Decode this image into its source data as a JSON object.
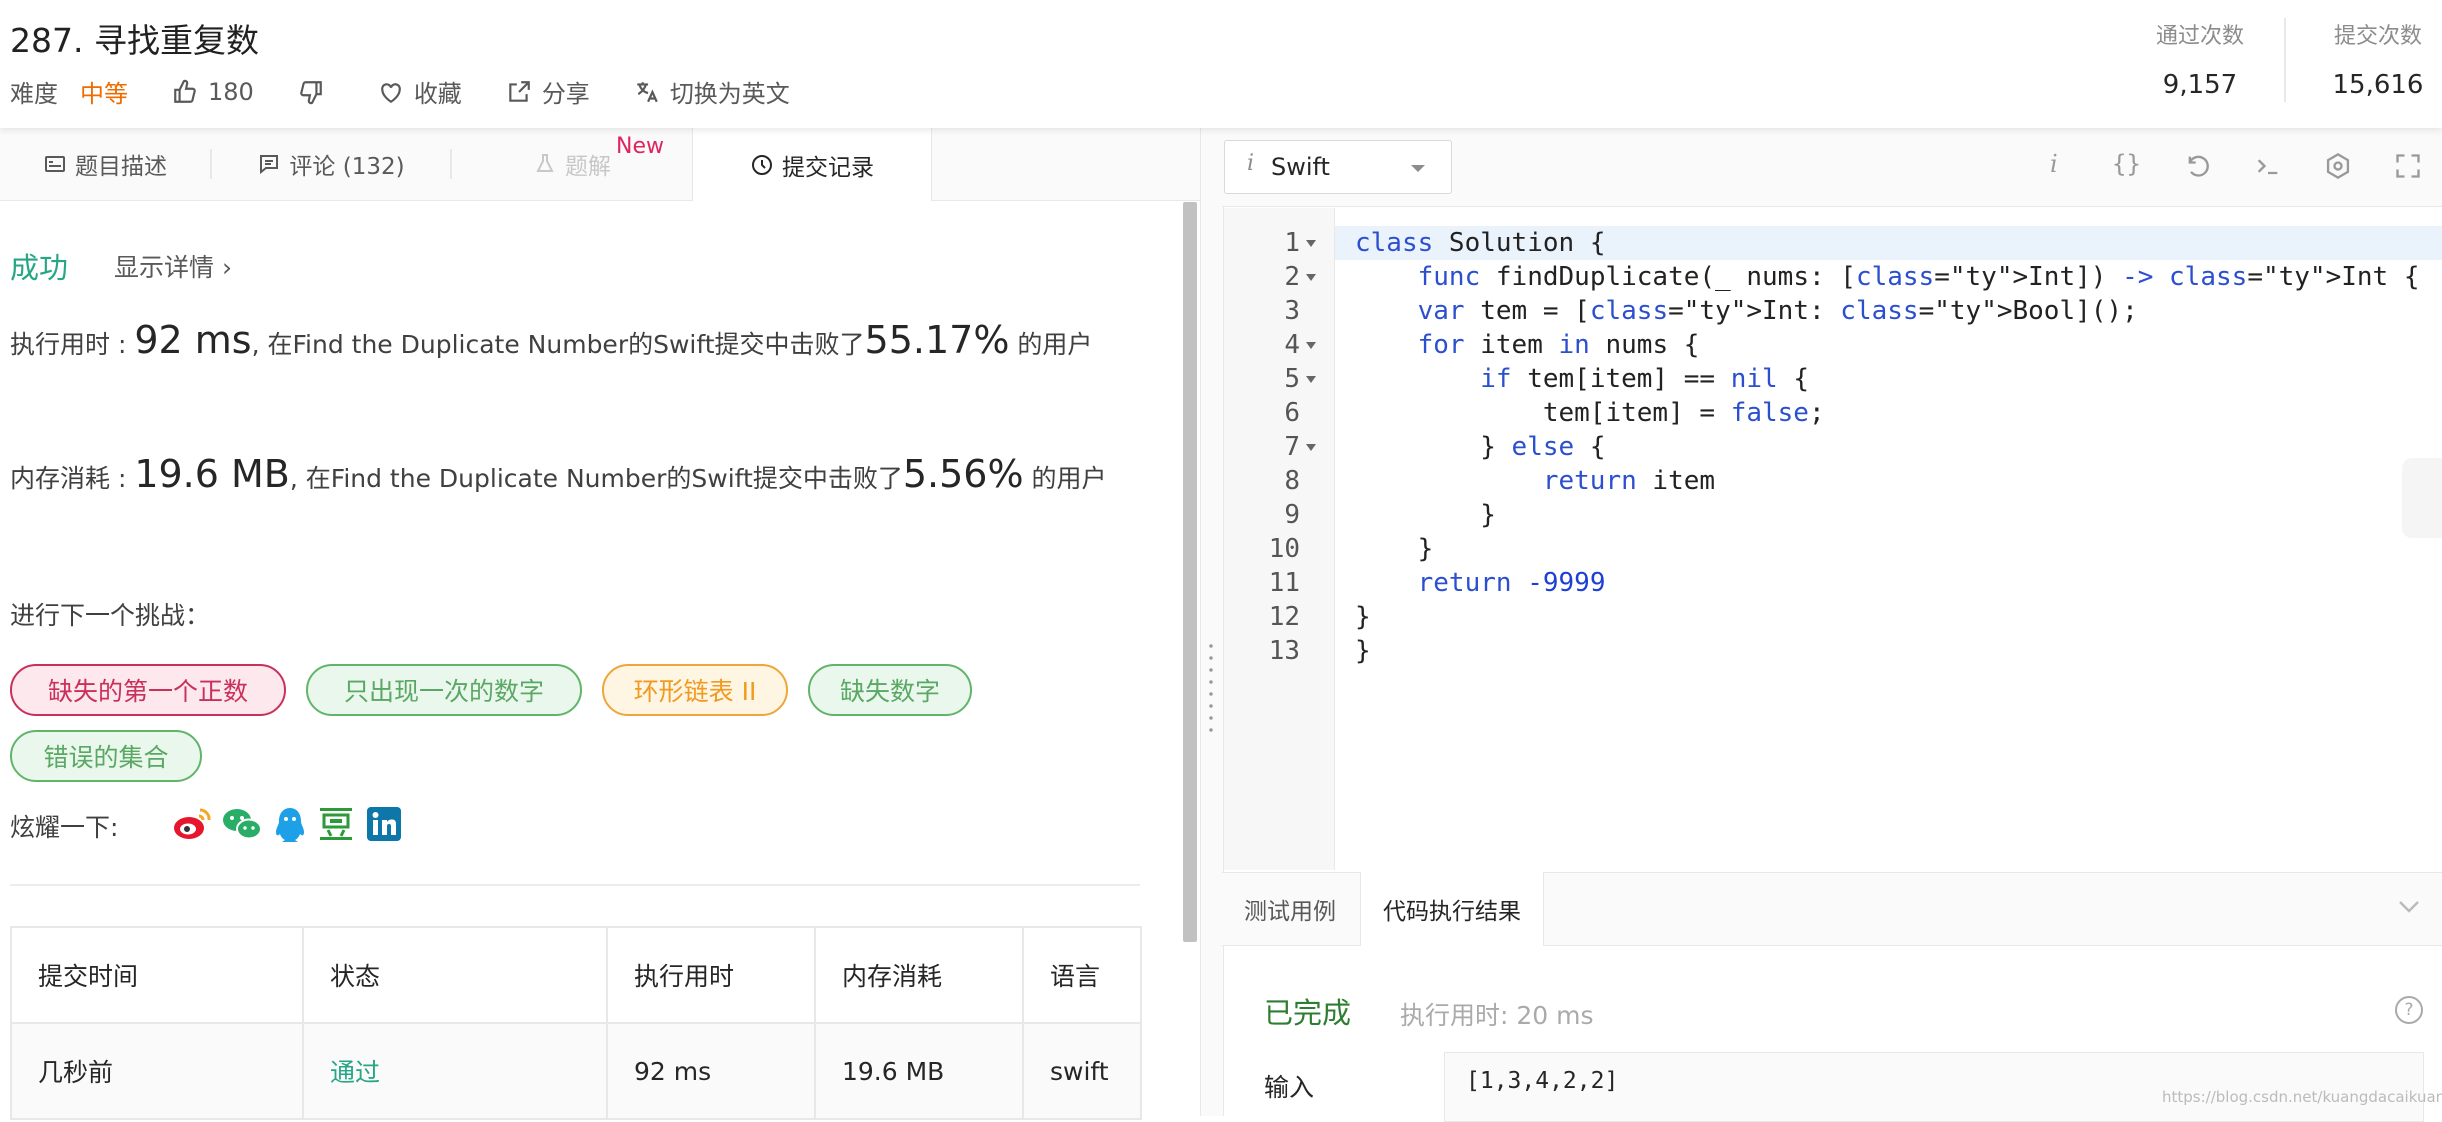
{
  "problem": {
    "title": "287. 寻找重复数",
    "difficulty_label": "难度",
    "difficulty_value": "中等",
    "likes": "180",
    "favorite_label": "收藏",
    "share_label": "分享",
    "switch_lang_label": "切换为英文"
  },
  "stats": {
    "accepted_label": "通过次数",
    "accepted_value": "9,157",
    "submissions_label": "提交次数",
    "submissions_value": "15,616"
  },
  "tabs": [
    {
      "label": "题目描述"
    },
    {
      "label": "评论 (132)"
    },
    {
      "label": "题解",
      "badge": "New"
    },
    {
      "label": "提交记录"
    }
  ],
  "result": {
    "status": "成功",
    "details_link": "显示详情 ›",
    "runtime_prefix": "执行用时 : ",
    "runtime_value": "92 ms",
    "runtime_middle": ", 在Find the Duplicate Number的Swift提交中击败了",
    "runtime_percent": "55.17%",
    "runtime_suffix": " 的用户",
    "memory_prefix": "内存消耗 : ",
    "memory_value": "19.6 MB",
    "memory_middle": ", 在Find the Duplicate Number的Swift提交中击败了",
    "memory_percent": "5.56%",
    "memory_suffix": " 的用户",
    "next_challenge_label": "进行下一个挑战：",
    "challenges": [
      {
        "label": "缺失的第一个正数",
        "color": "#c9305a"
      },
      {
        "label": "只出现一次的数字",
        "color": "#5aa864"
      },
      {
        "label": "环形链表 II",
        "color": "#f09a20"
      },
      {
        "label": "缺失数字",
        "color": "#5aa864"
      },
      {
        "label": "错误的集合",
        "color": "#5aa864"
      }
    ],
    "share_label": "炫耀一下:",
    "share_icons": [
      "weibo-icon",
      "wechat-icon",
      "qq-icon",
      "douban-icon",
      "linkedin-icon"
    ]
  },
  "submissions_table": {
    "headers": [
      "提交时间",
      "状态",
      "执行用时",
      "内存消耗",
      "语言"
    ],
    "rows": [
      [
        "几秒前",
        "通过",
        "92 ms",
        "19.6 MB",
        "swift"
      ]
    ]
  },
  "editor": {
    "language": "Swift",
    "line_numbers": [
      "1",
      "2",
      "3",
      "4",
      "5",
      "6",
      "7",
      "8",
      "9",
      "10",
      "11",
      "12",
      "13"
    ],
    "code_lines": [
      "class Solution {",
      "    func findDuplicate(_ nums: [Int]) -> Int {",
      "    var tem = [Int: Bool]();",
      "    for item in nums {",
      "        if tem[item] == nil {",
      "            tem[item] = false;",
      "        } else {",
      "            return item",
      "        }",
      "    }",
      "    return -9999",
      "}",
      "}"
    ]
  },
  "bottom_panel": {
    "tabs": [
      "测试用例",
      "代码执行结果"
    ],
    "exec_status": "已完成",
    "exec_time": "执行用时: 20 ms",
    "input_label": "输入",
    "input_value": "[1,3,4,2,2]"
  },
  "watermark": "https://blog.csdn.net/kuangdacaikuang",
  "colors": {
    "accent_green": "#26a686",
    "difficulty_orange": "#ef6c00",
    "new_badge": "#e0245e"
  }
}
